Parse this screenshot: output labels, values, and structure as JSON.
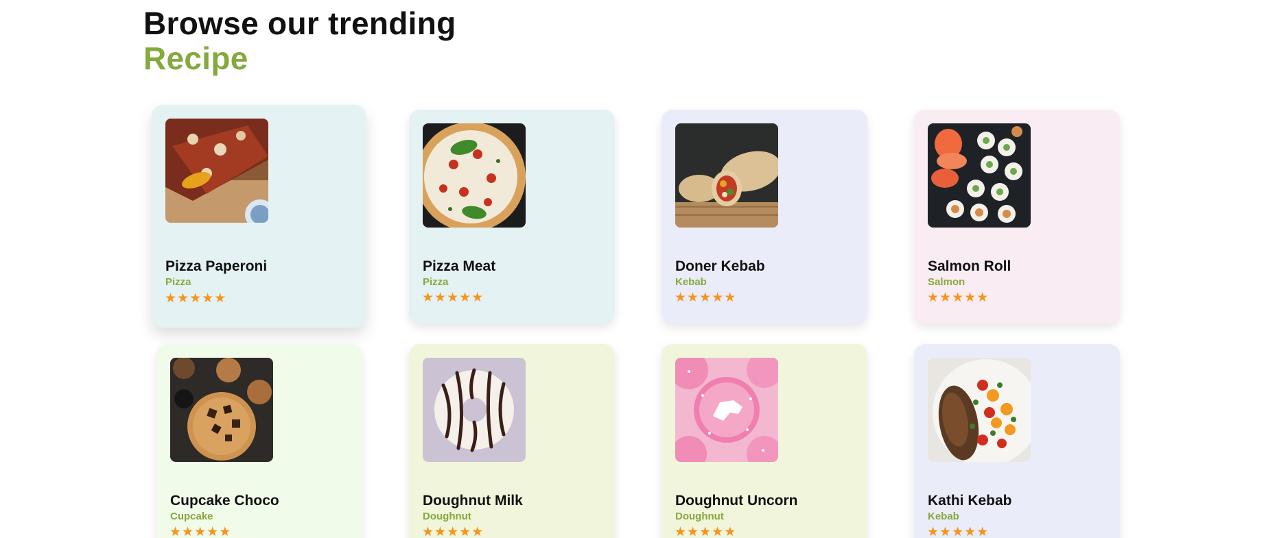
{
  "heading": {
    "line1": "Browse our trending",
    "line2": "Recipe"
  },
  "colors": {
    "accent": "#86a93e",
    "star": "#f7941d"
  },
  "cards": [
    {
      "title": "Pizza Paperoni",
      "category": "Pizza",
      "rating": 5,
      "background": "#e5f2f3",
      "image": "pizza-slices-photo"
    },
    {
      "title": "Pizza Meat",
      "category": "Pizza",
      "rating": 5,
      "background": "#e5f2f3",
      "image": "pizza-whole-photo"
    },
    {
      "title": "Doner Kebab",
      "category": "Kebab",
      "rating": 5,
      "background": "#eaedf9",
      "image": "wrap-photo"
    },
    {
      "title": "Salmon Roll",
      "category": "Salmon",
      "rating": 5,
      "background": "#f9ecf2",
      "image": "sushi-photo"
    },
    {
      "title": "Cupcake Choco",
      "category": "Cupcake",
      "rating": 5,
      "background": "#f0fbea",
      "image": "cookie-photo"
    },
    {
      "title": "Doughnut Milk",
      "category": "Doughnut",
      "rating": 5,
      "background": "#f1f5db",
      "image": "striped-donut-photo"
    },
    {
      "title": "Doughnut Uncorn",
      "category": "Doughnut",
      "rating": 5,
      "background": "#f1f5db",
      "image": "pink-donut-photo"
    },
    {
      "title": "Kathi Kebab",
      "category": "Kebab",
      "rating": 5,
      "background": "#eaedf9",
      "image": "kebab-plate-photo"
    }
  ]
}
